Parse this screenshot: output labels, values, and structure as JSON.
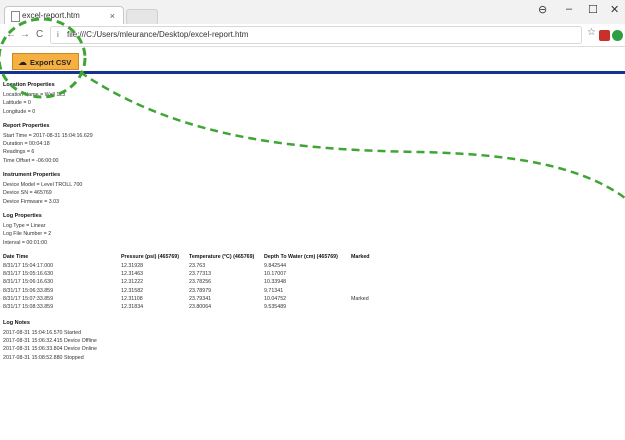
{
  "browser": {
    "tab_title": "excel-report.htm",
    "tab_close": "×",
    "url": "file:///C:/Users/mleurance/Desktop/excel-report.htm",
    "info_icon": "i",
    "window_controls": {
      "minimize": "–",
      "maximize": "☐",
      "close": "✕",
      "account": "⊖"
    },
    "nav": {
      "back": "←",
      "forward": "→",
      "reload": "C"
    }
  },
  "toolbar": {
    "export_label": "Export CSV",
    "export_icon": "cloud-download-icon"
  },
  "colors": {
    "accent_band": "#15358c",
    "export_button": "#f6b041",
    "annotation": "#3fa535"
  },
  "location": {
    "heading": "Location Properties",
    "lines": [
      "Location Name = Well 123",
      "Latitude = 0",
      "Longitude = 0"
    ]
  },
  "report_props": {
    "heading": "Report Properties",
    "lines": [
      "Start Time = 2017-08-31 15:04:16.629",
      "Duration = 00:04:18",
      "Readings = 6",
      "Time Offset = -06:00:00"
    ]
  },
  "instrument": {
    "heading": "Instrument Properties",
    "lines": [
      "Device Model = Level TROLL 700",
      "Device SN = 465769",
      "Device Firmware = 3.03"
    ]
  },
  "log_props": {
    "heading": "Log Properties",
    "lines": [
      "Log Type = Linear",
      "Log File Number = 2",
      "Interval = 00:01:00"
    ]
  },
  "readings": {
    "headers": [
      "Date Time",
      "Pressure (psi) (465769)",
      "Temperature (°C) (465769)",
      "Depth To Water (cm) (465769)",
      "Marked"
    ],
    "rows": [
      [
        "8/31/17 15:04:17.000",
        "12.31928",
        "23.763",
        "9.842544",
        ""
      ],
      [
        "8/31/17 15:05:16.630",
        "12.31463",
        "23.77313",
        "10.17007",
        ""
      ],
      [
        "8/31/17 15:06:16.630",
        "12.31222",
        "23.78256",
        "10.33948",
        ""
      ],
      [
        "8/31/17 15:06:33.859",
        "12.31582",
        "23.78979",
        "9.71341",
        ""
      ],
      [
        "8/31/17 15:07:33.859",
        "12.31108",
        "23.79341",
        "10.04752",
        "Marked"
      ],
      [
        "8/31/17 15:08:33.859",
        "12.31834",
        "23.80064",
        "9.535489",
        ""
      ]
    ]
  },
  "log_notes": {
    "heading": "Log Notes",
    "lines": [
      "2017-08-31 15:04:16.570 Started",
      "2017-08-31 15:06:32.415 Device Offline",
      "2017-08-31 15:06:33.804 Device Online",
      "2017-08-31 15:08:52.880 Stopped"
    ]
  }
}
